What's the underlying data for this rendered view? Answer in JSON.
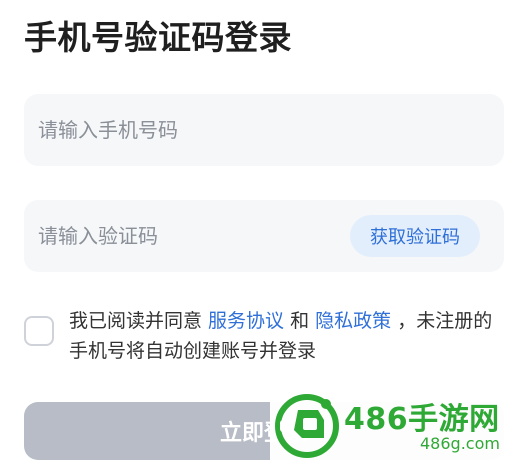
{
  "page": {
    "title": "手机号验证码登录"
  },
  "phone_field": {
    "placeholder": "请输入手机号码",
    "value": ""
  },
  "code_field": {
    "placeholder": "请输入验证码",
    "value": "",
    "get_code_label": "获取验证码"
  },
  "agreement": {
    "checked": false,
    "prefix": "我已阅读并同意 ",
    "service_link": "服务协议",
    "and": " 和 ",
    "privacy_link": "隐私政策",
    "suffix": " ，未注册的手机号将自动创建账号并登录"
  },
  "login_button": {
    "label": "立即登录"
  },
  "watermark": {
    "title": "486手游网",
    "subtitle": "486g.com"
  },
  "colors": {
    "accent": "#2f6fd8",
    "button_disabled": "#b7bcc6",
    "field_bg": "#f6f7f9",
    "watermark": "#2fa935"
  }
}
